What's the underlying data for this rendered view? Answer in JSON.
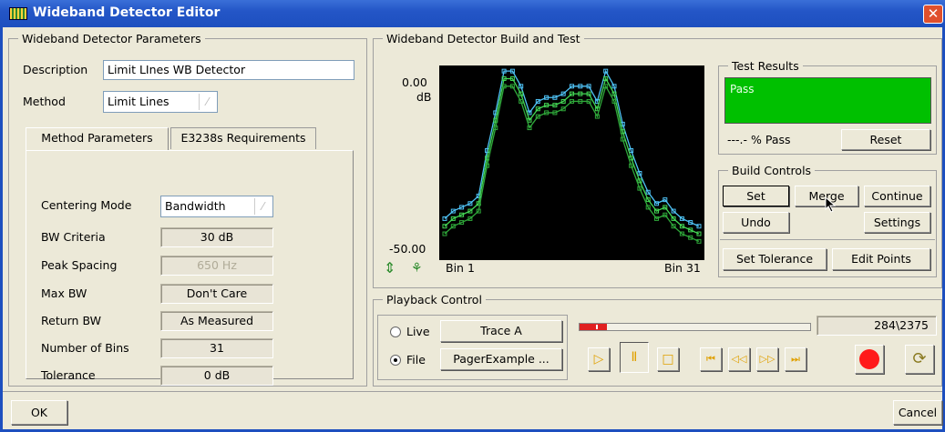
{
  "window": {
    "title": "Wideband Detector Editor"
  },
  "params": {
    "legend": "Wideband Detector Parameters",
    "description_label": "Description",
    "description_value": "Limit LInes WB Detector",
    "method_label": "Method",
    "method_value": "Limit Lines",
    "tabs": [
      "Method Parameters",
      "E3238s Requirements"
    ],
    "rows": [
      {
        "label": "Centering Mode",
        "value": "Bandwidth"
      },
      {
        "label": "BW Criteria",
        "value": "30 dB"
      },
      {
        "label": "Peak Spacing",
        "value": "650 Hz"
      },
      {
        "label": "Max BW",
        "value": "Don't Care"
      },
      {
        "label": "Return BW",
        "value": "As Measured"
      },
      {
        "label": "Number of Bins",
        "value": "31"
      },
      {
        "label": "Tolerance",
        "value": "0 dB"
      }
    ]
  },
  "build": {
    "legend": "Wideband Detector Build and Test",
    "chart_data": {
      "type": "line",
      "y_top_label": "0.00",
      "y_unit": "dB",
      "y_bottom_label": "-50.00",
      "x_left_label": "Bin 1",
      "x_right_label": "Bin 31",
      "ylim": [
        -50,
        0
      ],
      "x": [
        1,
        2,
        3,
        4,
        5,
        6,
        7,
        8,
        9,
        10,
        11,
        12,
        13,
        14,
        15,
        16,
        17,
        18,
        19,
        20,
        21,
        22,
        23,
        24,
        25,
        26,
        27,
        28,
        29,
        30,
        31
      ],
      "series": [
        {
          "color": "#4fc3f7",
          "values": [
            -40,
            -38,
            -37,
            -36,
            -34,
            -22,
            -12,
            -1,
            -1,
            -5,
            -12,
            -9,
            -8,
            -8,
            -7,
            -5,
            -5,
            -5,
            -9,
            -1,
            -5,
            -15,
            -22,
            -28,
            -33,
            -36,
            -35,
            -38,
            -40,
            -41,
            -42
          ]
        },
        {
          "color": "#44d855",
          "values": [
            -42,
            -40,
            -39,
            -38,
            -36,
            -24,
            -14,
            -3,
            -3,
            -7,
            -14,
            -11,
            -10,
            -10,
            -9,
            -7,
            -7,
            -7,
            -11,
            -3,
            -7,
            -17,
            -24,
            -30,
            -35,
            -38,
            -37,
            -40,
            -42,
            -43,
            -44
          ]
        },
        {
          "color": "#2fa83a",
          "values": [
            -44,
            -42,
            -41,
            -40,
            -38,
            -26,
            -16,
            -5,
            -5,
            -9,
            -16,
            -13,
            -12,
            -12,
            -11,
            -9,
            -9,
            -9,
            -13,
            -5,
            -9,
            -19,
            -26,
            -32,
            -37,
            -40,
            -39,
            -42,
            -44,
            -45,
            -46
          ]
        }
      ]
    }
  },
  "results": {
    "legend": "Test Results",
    "status": "Pass",
    "status_color": "#00c000",
    "percent": "---.- % Pass",
    "reset": "Reset"
  },
  "controls": {
    "legend": "Build Controls",
    "set": "Set",
    "merge": "Merge",
    "continue": "Continue",
    "undo": "Undo",
    "settings": "Settings",
    "set_tolerance": "Set Tolerance",
    "edit_points": "Edit Points"
  },
  "playback": {
    "legend": "Playback Control",
    "live_label": "Live",
    "live_value": "Trace A",
    "file_label": "File",
    "file_value": "PagerExample ...",
    "counter": "284\\2375",
    "progress_fraction": 0.12
  },
  "footer": {
    "ok": "OK",
    "cancel": "Cancel"
  }
}
